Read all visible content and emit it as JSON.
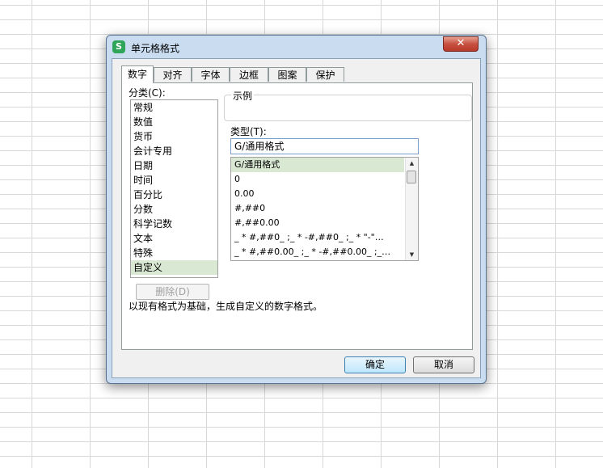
{
  "dialog": {
    "icon_letter": "S",
    "title": "单元格格式",
    "close_glyph": "✕"
  },
  "tabs": [
    "数字",
    "对齐",
    "字体",
    "边框",
    "图案",
    "保护"
  ],
  "category": {
    "label": "分类(C):",
    "items": [
      "常规",
      "数值",
      "货币",
      "会计专用",
      "日期",
      "时间",
      "百分比",
      "分数",
      "科学记数",
      "文本",
      "特殊",
      "自定义"
    ],
    "selected": "自定义",
    "delete_button": "删除(D)"
  },
  "sample": {
    "label": "示例",
    "value": ""
  },
  "type": {
    "label": "类型(T):",
    "input_value": "G/通用格式",
    "formats": [
      "G/通用格式",
      "0",
      "0.00",
      "#,##0",
      "#,##0.00",
      "_ * #,##0_ ;_ * -#,##0_ ;_ * \"-\"…",
      "_ * #,##0.00_ ;_ * -#,##0.00_ ;_…"
    ],
    "selected": "G/通用格式"
  },
  "description": "以现有格式为基础，生成自定义的数字格式。",
  "buttons": {
    "ok": "确定",
    "cancel": "取消"
  },
  "colors": {
    "selection": "#d9e8d2",
    "frame": "#c9dcf0"
  }
}
